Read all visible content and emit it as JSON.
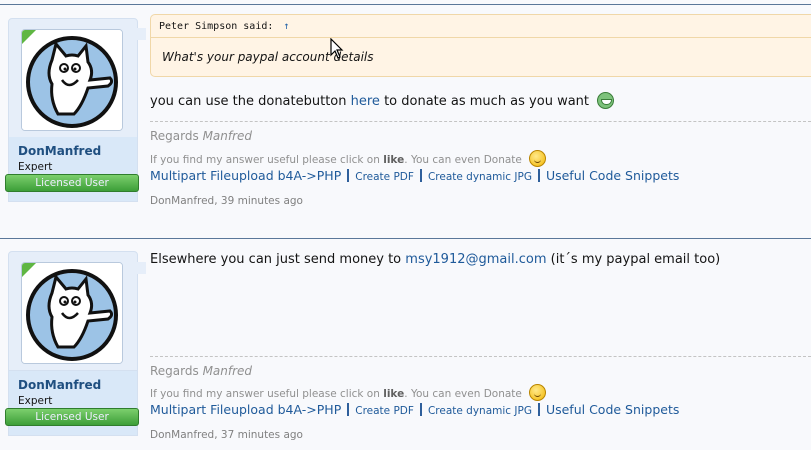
{
  "posts": [
    {
      "user": {
        "name": "DonManfred",
        "title": "Expert",
        "badge": "Licensed User"
      },
      "quote": {
        "author_line": "Peter Simpson said:",
        "arrow": "↑",
        "text": "What's your paypal account details"
      },
      "message": {
        "before": "you can use the donatebutton ",
        "link": "here",
        "after": " to donate as much as you want",
        "emoji": "grin-icon"
      },
      "meta": {
        "author": "DonManfred",
        "time": ", 39 minutes ago"
      }
    },
    {
      "user": {
        "name": "DonManfred",
        "title": "Expert",
        "badge": "Licensed User"
      },
      "message": {
        "before": "Elsewhere you can just send money to ",
        "link": "msy1912@gmail.com",
        "after": " (it´s my paypal email too)"
      },
      "meta": {
        "author": "DonManfred",
        "time": ", 37 minutes ago"
      }
    }
  ],
  "signature": {
    "regards": "Regards ",
    "regards_name": "Manfred",
    "useful_before": "If you find my answer useful please click on ",
    "useful_like": "like",
    "useful_after": ". You can even Donate",
    "links": [
      "Multipart Fileupload b4A->PHP",
      "Create PDF",
      "Create dynamic JPG",
      "Useful Code Snippets"
    ]
  },
  "colors": {
    "link": "#1f5a9a",
    "rule": "#5a7799",
    "licensed_badge": "#3c9e38",
    "quote_bg": "#fff4e5"
  }
}
